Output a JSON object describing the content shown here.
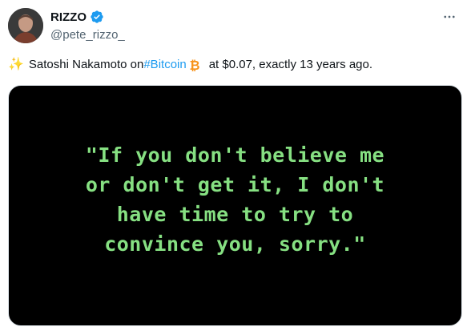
{
  "author": {
    "display_name": "RIZZO",
    "handle": "@pete_rizzo_",
    "verified": true,
    "avatar_icon": "person-avatar"
  },
  "tweet": {
    "text_before": "Satoshi Nakamoto on ",
    "hashtag": "#Bitcoin",
    "text_after": "at $0.07, exactly 13 years ago.",
    "emoji_sparkles": "✨",
    "emoji_btc": "bitcoin-icon"
  },
  "media": {
    "quote": "\"If you don't believe me\nor don't get it, I don't\nhave time to try to\nconvince you, sorry.\"",
    "text_color": "#86e082",
    "background": "#000000"
  },
  "colors": {
    "accent": "#1d9bf0",
    "verified": "#1d9bf0",
    "bitcoin": "#f7931a"
  }
}
